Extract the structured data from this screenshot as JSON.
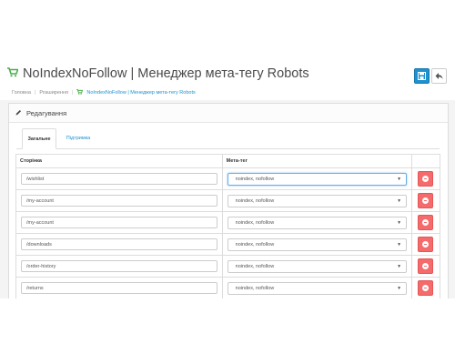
{
  "header": {
    "title": "NoIndexNoFollow | Менеджер мета-тегу Robots",
    "save_icon": "save-icon",
    "back_icon": "reply-icon"
  },
  "breadcrumb": {
    "items": [
      "Головна",
      "Розширення"
    ],
    "current": "NoIndexNoFollow | Менеджер мета-тегу Robots"
  },
  "panel": {
    "heading": "Редагування",
    "tabs": [
      "Загальне",
      "Підтримка"
    ]
  },
  "table": {
    "headers": [
      "Сторінка",
      "Мета-тег",
      ""
    ],
    "rows": [
      {
        "page": "/wishlist",
        "tag": "noindex, nofollow"
      },
      {
        "page": "/my-account",
        "tag": "noindex, nofollow"
      },
      {
        "page": "/my-account",
        "tag": "noindex, nofollow"
      },
      {
        "page": "/downloads",
        "tag": "noindex, nofollow"
      },
      {
        "page": "/order-history",
        "tag": "noindex, nofollow"
      },
      {
        "page": "/returns",
        "tag": "noindex, nofollow"
      },
      {
        "page": "",
        "tag": ""
      }
    ]
  },
  "colors": {
    "primary": "#1e91cf",
    "danger": "#f56b6b",
    "cart": "#4cae4c"
  }
}
